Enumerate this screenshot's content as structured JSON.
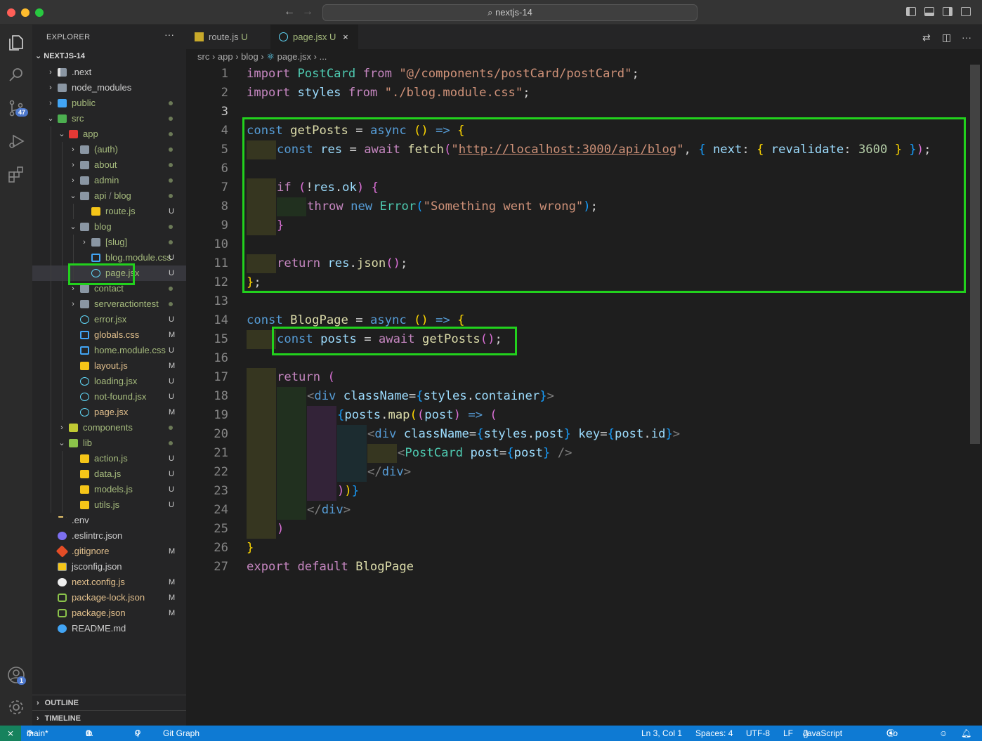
{
  "window": {
    "title": "nextjs-14"
  },
  "explorer": {
    "title": "EXPLORER",
    "more": "···",
    "root": "NEXTJS-14",
    "items": [
      {
        "label": ".next",
        "depth": 0,
        "chev": "right",
        "icon": "folder-next",
        "status": ""
      },
      {
        "label": "node_modules",
        "depth": 0,
        "chev": "right",
        "icon": "folder",
        "status": ""
      },
      {
        "label": "public",
        "depth": 0,
        "chev": "right",
        "icon": "folder-public",
        "status": "dot"
      },
      {
        "label": "src",
        "depth": 0,
        "chev": "down",
        "icon": "folder-src",
        "status": "dot"
      },
      {
        "label": "app",
        "depth": 1,
        "chev": "down",
        "icon": "folder-app",
        "status": "dot"
      },
      {
        "label": "(auth)",
        "depth": 2,
        "chev": "right",
        "icon": "folder",
        "status": "dot"
      },
      {
        "label": "about",
        "depth": 2,
        "chev": "right",
        "icon": "folder",
        "status": "dot"
      },
      {
        "label": "admin",
        "depth": 2,
        "chev": "right",
        "icon": "folder-admin",
        "status": "dot"
      },
      {
        "label": "api",
        "label2": "blog",
        "depth": 2,
        "chev": "down",
        "icon": "folder",
        "status": "dot"
      },
      {
        "label": "route.js",
        "depth": 3,
        "chev": "",
        "icon": "js",
        "status": "U"
      },
      {
        "label": "blog",
        "depth": 2,
        "chev": "down",
        "icon": "folder",
        "status": "dot"
      },
      {
        "label": "[slug]",
        "depth": 3,
        "chev": "right",
        "icon": "folder",
        "status": "dot"
      },
      {
        "label": "blog.module.css",
        "depth": 3,
        "chev": "",
        "icon": "css",
        "status": "U"
      },
      {
        "label": "page.jsx",
        "depth": 3,
        "chev": "",
        "icon": "react",
        "status": "U",
        "selected": true
      },
      {
        "label": "contact",
        "depth": 2,
        "chev": "right",
        "icon": "folder",
        "status": "dot"
      },
      {
        "label": "serveractiontest",
        "depth": 2,
        "chev": "right",
        "icon": "folder",
        "status": "dot"
      },
      {
        "label": "error.jsx",
        "depth": 2,
        "chev": "",
        "icon": "react",
        "status": "U"
      },
      {
        "label": "globals.css",
        "depth": 2,
        "chev": "",
        "icon": "css",
        "status": "M"
      },
      {
        "label": "home.module.css",
        "depth": 2,
        "chev": "",
        "icon": "css",
        "status": "U"
      },
      {
        "label": "layout.js",
        "depth": 2,
        "chev": "",
        "icon": "js",
        "status": "M"
      },
      {
        "label": "loading.jsx",
        "depth": 2,
        "chev": "",
        "icon": "react",
        "status": "U"
      },
      {
        "label": "not-found.jsx",
        "depth": 2,
        "chev": "",
        "icon": "react",
        "status": "U"
      },
      {
        "label": "page.jsx",
        "depth": 2,
        "chev": "",
        "icon": "react",
        "status": "M"
      },
      {
        "label": "components",
        "depth": 1,
        "chev": "right",
        "icon": "folder-components",
        "status": "dot"
      },
      {
        "label": "lib",
        "depth": 1,
        "chev": "down",
        "icon": "folder-lib",
        "status": "dot"
      },
      {
        "label": "action.js",
        "depth": 2,
        "chev": "",
        "icon": "js",
        "status": "U"
      },
      {
        "label": "data.js",
        "depth": 2,
        "chev": "",
        "icon": "js",
        "status": "U"
      },
      {
        "label": "models.js",
        "depth": 2,
        "chev": "",
        "icon": "js",
        "status": "U"
      },
      {
        "label": "utils.js",
        "depth": 2,
        "chev": "",
        "icon": "js",
        "status": "U"
      },
      {
        "label": ".env",
        "depth": 0,
        "chev": "",
        "icon": "env",
        "status": ""
      },
      {
        "label": ".eslintrc.json",
        "depth": 0,
        "chev": "",
        "icon": "eslint",
        "status": ""
      },
      {
        "label": ".gitignore",
        "depth": 0,
        "chev": "",
        "icon": "git",
        "status": "M"
      },
      {
        "label": "jsconfig.json",
        "depth": 0,
        "chev": "",
        "icon": "jsconfig",
        "status": ""
      },
      {
        "label": "next.config.js",
        "depth": 0,
        "chev": "",
        "icon": "next",
        "status": "M"
      },
      {
        "label": "package-lock.json",
        "depth": 0,
        "chev": "",
        "icon": "npm",
        "status": "M"
      },
      {
        "label": "package.json",
        "depth": 0,
        "chev": "",
        "icon": "npm",
        "status": "M"
      },
      {
        "label": "README.md",
        "depth": 0,
        "chev": "",
        "icon": "info",
        "status": ""
      }
    ],
    "outline": "OUTLINE",
    "timeline": "TIMELINE"
  },
  "activity": {
    "scm_badge": "47",
    "accounts_badge": "1"
  },
  "tabs": [
    {
      "label": "route.js",
      "status": "U",
      "icon": "js",
      "active": false
    },
    {
      "label": "page.jsx",
      "status": "U",
      "icon": "react",
      "active": true,
      "close": "×"
    }
  ],
  "breadcrumb": [
    "src",
    "app",
    "blog",
    "page.jsx",
    "..."
  ],
  "editor": {
    "current_line": 3,
    "lines": [
      [
        [
          "kc",
          "import "
        ],
        [
          "cl",
          "PostCard"
        ],
        [
          "kc",
          " from "
        ],
        [
          "str",
          "\"@/components/postCard/postCard\""
        ],
        [
          "pl",
          ";"
        ]
      ],
      [
        [
          "kc",
          "import "
        ],
        [
          "vr",
          "styles"
        ],
        [
          "kc",
          " from "
        ],
        [
          "str",
          "\"./blog.module.css\""
        ],
        [
          "pl",
          ";"
        ]
      ],
      [],
      [
        [
          "kw",
          "const "
        ],
        [
          "fn",
          "getPosts"
        ],
        [
          "pl",
          " = "
        ],
        [
          "kw",
          "async "
        ],
        [
          "b1",
          "()"
        ],
        [
          "kw",
          " => "
        ],
        [
          "b1",
          "{"
        ]
      ],
      [
        [
          "ind1",
          ""
        ],
        [
          "kw",
          "const "
        ],
        [
          "vr",
          "res"
        ],
        [
          "pl",
          " = "
        ],
        [
          "kc",
          "await "
        ],
        [
          "fn",
          "fetch"
        ],
        [
          "b2",
          "("
        ],
        [
          "str",
          "\""
        ],
        [
          "strl",
          "http://localhost:3000/api/blog"
        ],
        [
          "str",
          "\""
        ],
        [
          "pl",
          ", "
        ],
        [
          "b3",
          "{ "
        ],
        [
          "vr",
          "next"
        ],
        [
          "pl",
          ": "
        ],
        [
          "b1",
          "{ "
        ],
        [
          "vr",
          "revalidate"
        ],
        [
          "pl",
          ": "
        ],
        [
          "num",
          "3600"
        ],
        [
          "b1",
          " }"
        ],
        [
          "b3",
          " }"
        ],
        [
          "b2",
          ")"
        ],
        [
          "pl",
          ";"
        ]
      ],
      [],
      [
        [
          "ind1",
          ""
        ],
        [
          "kc",
          "if "
        ],
        [
          "b2",
          "("
        ],
        [
          "pl",
          "!"
        ],
        [
          "vr",
          "res"
        ],
        [
          "pl",
          "."
        ],
        [
          "vr",
          "ok"
        ],
        [
          "b2",
          ")"
        ],
        [
          "b2",
          " {"
        ]
      ],
      [
        [
          "ind2",
          ""
        ],
        [
          "kc",
          "throw "
        ],
        [
          "kw",
          "new "
        ],
        [
          "cl",
          "Error"
        ],
        [
          "b3",
          "("
        ],
        [
          "str",
          "\"Something went wrong\""
        ],
        [
          "b3",
          ")"
        ],
        [
          "pl",
          ";"
        ]
      ],
      [
        [
          "ind1",
          ""
        ],
        [
          "b2",
          "}"
        ]
      ],
      [],
      [
        [
          "ind1",
          ""
        ],
        [
          "kc",
          "return "
        ],
        [
          "vr",
          "res"
        ],
        [
          "pl",
          "."
        ],
        [
          "fn",
          "json"
        ],
        [
          "b2",
          "()"
        ],
        [
          "pl",
          ";"
        ]
      ],
      [
        [
          "b1",
          "}"
        ],
        [
          "pl",
          ";"
        ]
      ],
      [],
      [
        [
          "kw",
          "const "
        ],
        [
          "fn",
          "BlogPage"
        ],
        [
          "pl",
          " = "
        ],
        [
          "kw",
          "async "
        ],
        [
          "b1",
          "()"
        ],
        [
          "kw",
          " => "
        ],
        [
          "b1",
          "{"
        ]
      ],
      [
        [
          "ind1",
          ""
        ],
        [
          "kw",
          "const "
        ],
        [
          "vr",
          "posts"
        ],
        [
          "pl",
          " = "
        ],
        [
          "kc",
          "await "
        ],
        [
          "fn",
          "getPosts"
        ],
        [
          "b2",
          "()"
        ],
        [
          "pl",
          ";"
        ]
      ],
      [],
      [
        [
          "ind1",
          ""
        ],
        [
          "kc",
          "return "
        ],
        [
          "b2",
          "("
        ]
      ],
      [
        [
          "ind2",
          ""
        ],
        [
          "pn",
          "<"
        ],
        [
          "tg",
          "div "
        ],
        [
          "vr",
          "className"
        ],
        [
          "pl",
          "="
        ],
        [
          "b3",
          "{"
        ],
        [
          "vr",
          "styles"
        ],
        [
          "pl",
          "."
        ],
        [
          "vr",
          "container"
        ],
        [
          "b3",
          "}"
        ],
        [
          "pn",
          ">"
        ]
      ],
      [
        [
          "ind3",
          ""
        ],
        [
          "b3",
          "{"
        ],
        [
          "vr",
          "posts"
        ],
        [
          "pl",
          "."
        ],
        [
          "fn",
          "map"
        ],
        [
          "b1",
          "("
        ],
        [
          "b2",
          "("
        ],
        [
          "vr",
          "post"
        ],
        [
          "b2",
          ")"
        ],
        [
          "kw",
          " => "
        ],
        [
          "b2",
          "("
        ]
      ],
      [
        [
          "ind4",
          ""
        ],
        [
          "pn",
          "<"
        ],
        [
          "tg",
          "div "
        ],
        [
          "vr",
          "className"
        ],
        [
          "pl",
          "="
        ],
        [
          "b3",
          "{"
        ],
        [
          "vr",
          "styles"
        ],
        [
          "pl",
          "."
        ],
        [
          "vr",
          "post"
        ],
        [
          "b3",
          "}"
        ],
        [
          "vr",
          " key"
        ],
        [
          "pl",
          "="
        ],
        [
          "b3",
          "{"
        ],
        [
          "vr",
          "post"
        ],
        [
          "pl",
          "."
        ],
        [
          "vr",
          "id"
        ],
        [
          "b3",
          "}"
        ],
        [
          "pn",
          ">"
        ]
      ],
      [
        [
          "ind5",
          ""
        ],
        [
          "pn",
          "<"
        ],
        [
          "cl",
          "PostCard "
        ],
        [
          "vr",
          "post"
        ],
        [
          "pl",
          "="
        ],
        [
          "b3",
          "{"
        ],
        [
          "vr",
          "post"
        ],
        [
          "b3",
          "}"
        ],
        [
          "pn",
          " />"
        ]
      ],
      [
        [
          "ind4",
          ""
        ],
        [
          "pn",
          "</"
        ],
        [
          "tg",
          "div"
        ],
        [
          "pn",
          ">"
        ]
      ],
      [
        [
          "ind3",
          ""
        ],
        [
          "b2",
          ")"
        ],
        [
          "b1",
          ")"
        ],
        [
          "b3",
          "}"
        ]
      ],
      [
        [
          "ind2",
          ""
        ],
        [
          "pn",
          "</"
        ],
        [
          "tg",
          "div"
        ],
        [
          "pn",
          ">"
        ]
      ],
      [
        [
          "ind1",
          ""
        ],
        [
          "b2",
          ")"
        ]
      ],
      [
        [
          "b1",
          "}"
        ]
      ],
      [
        [
          "kc",
          "export "
        ],
        [
          "kc",
          "default "
        ],
        [
          "fn",
          "BlogPage"
        ]
      ]
    ]
  },
  "status": {
    "branch": "main*",
    "sync": "⟳",
    "errors": "0",
    "warnings": "0",
    "ports": "0",
    "git_graph": "Git Graph",
    "position": "Ln 3, Col 1",
    "spaces": "Spaces: 4",
    "encoding": "UTF-8",
    "eol": "LF",
    "language": "JavaScript JSX",
    "go_live": "Go Live"
  },
  "colors": {
    "highlight": "#22d11d",
    "statusbar": "#0e7ad3",
    "sidebar": "#252526",
    "editor": "#1e1e1e"
  }
}
